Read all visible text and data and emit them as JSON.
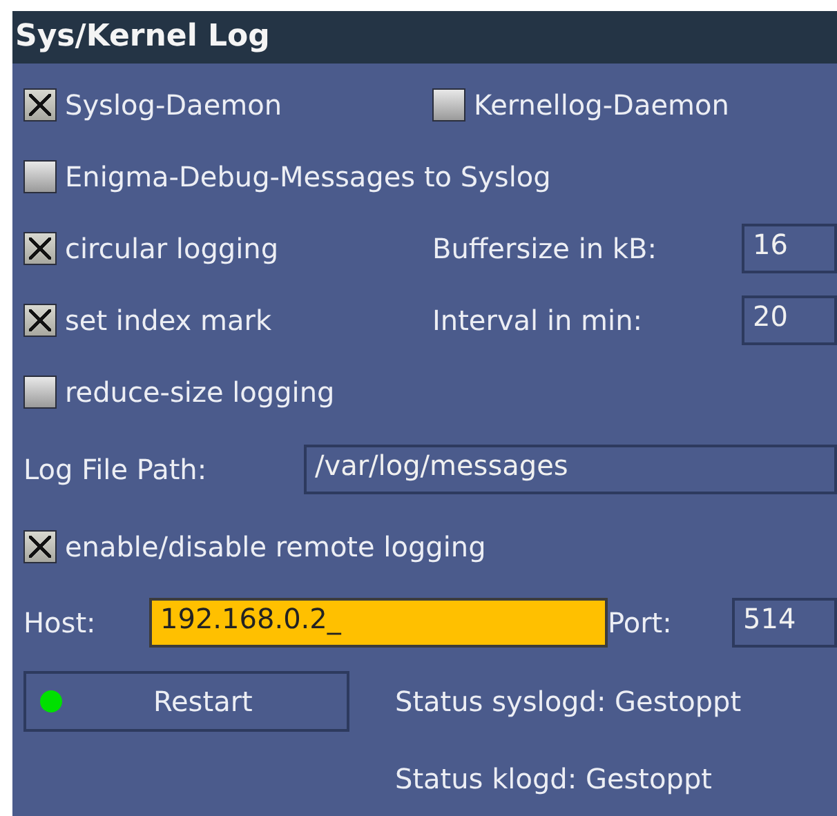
{
  "window": {
    "title": "Sys/Kernel Log"
  },
  "rows": [
    {
      "kind": "pair",
      "items": [
        {
          "kind": "checkbox",
          "label": "Syslog-Daemon",
          "checked": true
        },
        {
          "kind": "checkbox",
          "label": "Kernellog-Daemon",
          "checked": false
        }
      ]
    },
    {
      "kind": "pair",
      "items": [
        {
          "kind": "checkbox",
          "label": "Enigma-Debug-Messages to Syslog",
          "checked": false
        }
      ]
    },
    {
      "kind": "pair",
      "items": [
        {
          "kind": "checkbox",
          "label": "circular logging",
          "checked": true
        },
        {
          "kind": "label",
          "text": "Buffersize in kB:"
        },
        {
          "kind": "field",
          "value": "16",
          "selected": false
        }
      ]
    },
    {
      "kind": "pair",
      "items": [
        {
          "kind": "checkbox",
          "label": "set index mark",
          "checked": true
        },
        {
          "kind": "label",
          "text": "Interval in min:"
        },
        {
          "kind": "field",
          "value": "20",
          "selected": false
        }
      ]
    },
    {
      "kind": "pair",
      "items": [
        {
          "kind": "checkbox",
          "label": "reduce-size logging",
          "checked": false
        }
      ]
    },
    {
      "kind": "path",
      "items": [
        {
          "kind": "label",
          "text": "Log File Path:"
        },
        {
          "kind": "field",
          "value": "/var/log/messages",
          "selected": false
        }
      ]
    },
    {
      "kind": "pair",
      "items": [
        {
          "kind": "checkbox",
          "label": "enable/disable remote logging",
          "checked": true
        }
      ]
    },
    {
      "kind": "host",
      "items": [
        {
          "kind": "label",
          "text": "Host:"
        },
        {
          "kind": "field",
          "value": "192.168.0.2_",
          "selected": true
        },
        {
          "kind": "label",
          "text": "Port:"
        },
        {
          "kind": "field",
          "value": "514",
          "selected": false
        }
      ]
    },
    {
      "kind": "status",
      "items": [
        {
          "kind": "button",
          "label": "Restart",
          "color": "#00e000"
        },
        {
          "kind": "label",
          "text": "Status syslogd: Gestoppt"
        }
      ]
    },
    {
      "kind": "status",
      "items": [
        {
          "kind": "spacer"
        },
        {
          "kind": "label",
          "text": "Status klogd: Gestoppt"
        }
      ]
    }
  ]
}
